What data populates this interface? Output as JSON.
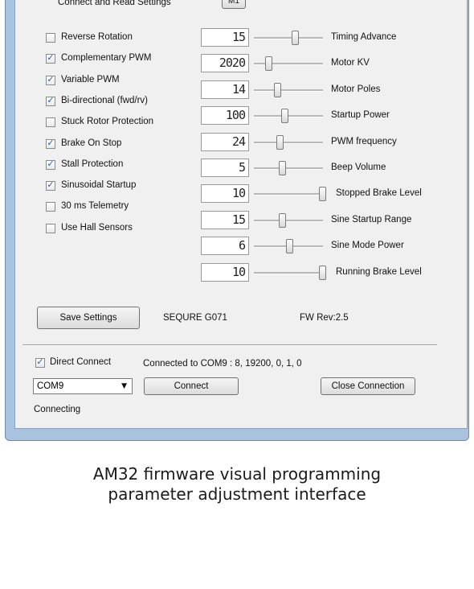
{
  "header": {
    "connect_read_label": "Connect and Read Settings",
    "motor_button_label": "M1"
  },
  "options": [
    {
      "label": "Reverse Rotation",
      "checked": false
    },
    {
      "label": "Complementary PWM",
      "checked": true
    },
    {
      "label": "Variable PWM",
      "checked": true
    },
    {
      "label": "Bi-directional (fwd/rv)",
      "checked": true
    },
    {
      "label": "Stuck Rotor Protection",
      "checked": false
    },
    {
      "label": "Brake On Stop",
      "checked": true
    },
    {
      "label": "Stall Protection",
      "checked": true
    },
    {
      "label": "Sinusoidal Startup",
      "checked": true
    },
    {
      "label": "30 ms Telemetry",
      "checked": false
    },
    {
      "label": "Use Hall Sensors",
      "checked": false
    }
  ],
  "parameters": [
    {
      "label": "Timing Advance",
      "value": "15",
      "level": 0.6
    },
    {
      "label": "Motor KV",
      "value": "2020",
      "level": 0.22
    },
    {
      "label": "Motor Poles",
      "value": "14",
      "level": 0.35
    },
    {
      "label": "Startup Power",
      "value": "100",
      "level": 0.45
    },
    {
      "label": "PWM frequency",
      "value": "24",
      "level": 0.38
    },
    {
      "label": "Beep Volume",
      "value": "5",
      "level": 0.42
    },
    {
      "label": "Stopped Brake Level",
      "value": "10",
      "level": 1.0
    },
    {
      "label": "Sine Startup Range",
      "value": "15",
      "level": 0.42
    },
    {
      "label": "Sine Mode Power",
      "value": "6",
      "level": 0.52
    },
    {
      "label": "Running Brake Level",
      "value": "10",
      "level": 1.0
    }
  ],
  "footer": {
    "save_label": "Save Settings",
    "device_name": "SEQURE G071",
    "fw_rev": "FW Rev:2.5"
  },
  "connection": {
    "direct_connect_label": "Direct Connect",
    "direct_connect_checked": true,
    "status_detail": "Connected to COM9 : 8, 19200, 0, 1, 0",
    "port_selected": "COM9",
    "connect_label": "Connect",
    "close_label": "Close Connection",
    "state_text": "Connecting"
  },
  "caption": {
    "line1": "AM32 firmware visual programming",
    "line2": "parameter adjustment interface"
  }
}
